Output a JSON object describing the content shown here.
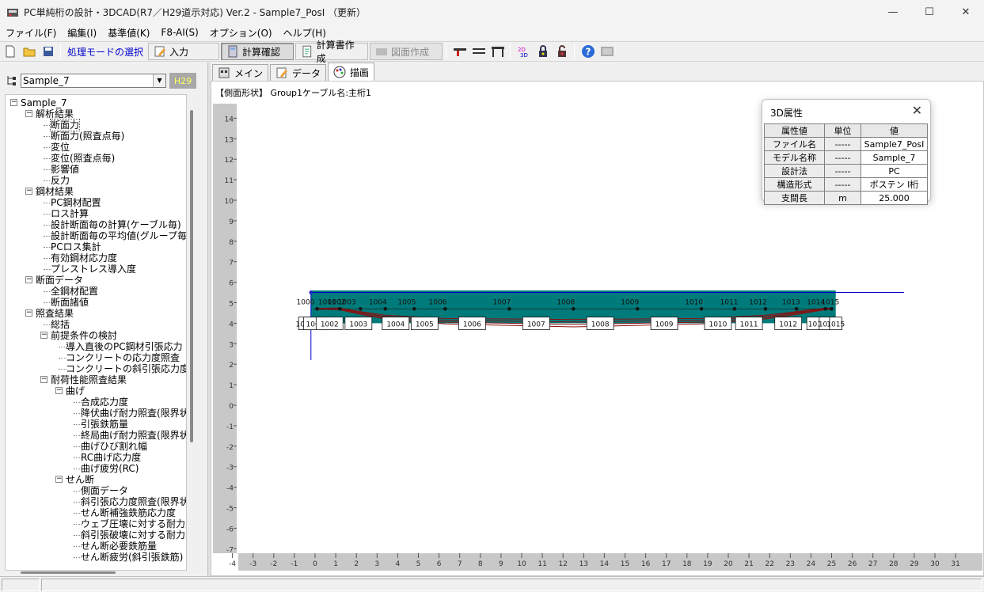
{
  "window": {
    "title": "PC単純桁の設計・3DCAD(R7／H29道示対応) Ver.2 - Sample7_PosI （更新）",
    "min": "—",
    "max": "☐",
    "close": "✕"
  },
  "menu": [
    "ファイル(F)",
    "編集(I)",
    "基準値(K)",
    "F8-AI(S)",
    "オプション(O)",
    "ヘルプ(H)"
  ],
  "toolbar": {
    "mode_label": "処理モードの選択",
    "buttons": [
      "入力",
      "計算確認",
      "計算書作成",
      "図面作成"
    ]
  },
  "left": {
    "combo_value": "Sample_7",
    "code_badge": "H29"
  },
  "tree": [
    {
      "label": "Sample_7",
      "level": 0,
      "exp": "-"
    },
    {
      "label": "解析結果",
      "level": 1,
      "exp": "-"
    },
    {
      "label": "断面力",
      "level": 2,
      "selected": true
    },
    {
      "label": "断面力(照査点毎)",
      "level": 2
    },
    {
      "label": "変位",
      "level": 2
    },
    {
      "label": "変位(照査点毎)",
      "level": 2
    },
    {
      "label": "影響値",
      "level": 2
    },
    {
      "label": "反力",
      "level": 2
    },
    {
      "label": "鋼材結果",
      "level": 1,
      "exp": "-"
    },
    {
      "label": "PC鋼材配置",
      "level": 2
    },
    {
      "label": "ロス計算",
      "level": 2
    },
    {
      "label": "設計断面毎の計算(ケーブル毎)",
      "level": 2
    },
    {
      "label": "設計断面毎の平均値(グループ毎",
      "level": 2
    },
    {
      "label": "PCロス集計",
      "level": 2
    },
    {
      "label": "有効鋼材応力度",
      "level": 2
    },
    {
      "label": "プレストレス導入度",
      "level": 2
    },
    {
      "label": "断面データ",
      "level": 1,
      "exp": "-"
    },
    {
      "label": "全鋼材配置",
      "level": 2
    },
    {
      "label": "断面諸値",
      "level": 2
    },
    {
      "label": "照査結果",
      "level": 1,
      "exp": "-"
    },
    {
      "label": "総括",
      "level": 2
    },
    {
      "label": "前提条件の検討",
      "level": 2,
      "exp": "-"
    },
    {
      "label": "導入直後のPC鋼材引張応力",
      "level": 3
    },
    {
      "label": "コンクリートの応力度照査",
      "level": 3
    },
    {
      "label": "コンクリートの斜引張応力度照",
      "level": 3
    },
    {
      "label": "耐荷性能照査結果",
      "level": 2,
      "exp": "-"
    },
    {
      "label": "曲げ",
      "level": 3,
      "exp": "-"
    },
    {
      "label": "合成応力度",
      "level": 4
    },
    {
      "label": "降伏曲げ耐力照査(限界状",
      "level": 4
    },
    {
      "label": "引張鉄筋量",
      "level": 4
    },
    {
      "label": "終局曲げ耐力照査(限界状",
      "level": 4
    },
    {
      "label": "曲げひび割れ幅",
      "level": 4
    },
    {
      "label": "RC曲げ応力度",
      "level": 4
    },
    {
      "label": "曲げ疲労(RC)",
      "level": 4
    },
    {
      "label": "せん断",
      "level": 3,
      "exp": "-"
    },
    {
      "label": "側面データ",
      "level": 4
    },
    {
      "label": "斜引張応力度照査(限界状",
      "level": 4
    },
    {
      "label": "せん断補強鉄筋応力度",
      "level": 4
    },
    {
      "label": "ウェブ圧壊に対する耐力照",
      "level": 4
    },
    {
      "label": "斜引張破壊に対する耐力照",
      "level": 4
    },
    {
      "label": "せん断必要鉄筋量",
      "level": 4
    },
    {
      "label": "せん断疲労(斜引張鉄筋)",
      "level": 4
    }
  ],
  "tabs": [
    "メイン",
    "データ",
    "描画"
  ],
  "caption": "【側面形状】 Group1ケーブル名:主桁1",
  "axes": {
    "y_ticks": [
      "14",
      "13",
      "12",
      "11",
      "10",
      "9",
      "8",
      "7",
      "6",
      "5",
      "4",
      "3",
      "2",
      "1",
      "0",
      "-1",
      "-2",
      "-3",
      "-4",
      "-5",
      "-6",
      "-7"
    ],
    "x_ticks": [
      "-4",
      "-3",
      "-2",
      "-1",
      "0",
      "1",
      "2",
      "3",
      "4",
      "5",
      "6",
      "7",
      "8",
      "9",
      "10",
      "11",
      "12",
      "13",
      "14",
      "15",
      "16",
      "17",
      "18",
      "19",
      "20",
      "21",
      "22",
      "23",
      "24",
      "25",
      "26",
      "27",
      "28",
      "29",
      "30",
      "31"
    ]
  },
  "drawing": {
    "top_labels": [
      "1000",
      "1001",
      "1002",
      "1003",
      "1004",
      "1005",
      "1006",
      "1007",
      "1008",
      "1009",
      "1010",
      "1011",
      "1012",
      "1013",
      "1014",
      "1015"
    ],
    "box_labels": [
      "1000",
      "1001",
      "1002",
      "1003",
      "1004",
      "1005",
      "1006",
      "1007",
      "1008",
      "1009",
      "1010",
      "1011",
      "1012",
      "1013",
      "1014",
      "1015"
    ],
    "colors": {
      "beam": "#007b7b",
      "cable": "#8b1010",
      "axis": "#0000cc"
    }
  },
  "attr": {
    "title": "3D属性",
    "headers": [
      "属性値",
      "単位",
      "値"
    ],
    "rows": [
      [
        "ファイル名",
        "-----",
        "Sample7_PosI"
      ],
      [
        "モデル名称",
        "-----",
        "Sample_7"
      ],
      [
        "設計法",
        "-----",
        "PC"
      ],
      [
        "構造形式",
        "-----",
        "ポステン I桁"
      ],
      [
        "支間長",
        "m",
        "25.000"
      ]
    ]
  }
}
